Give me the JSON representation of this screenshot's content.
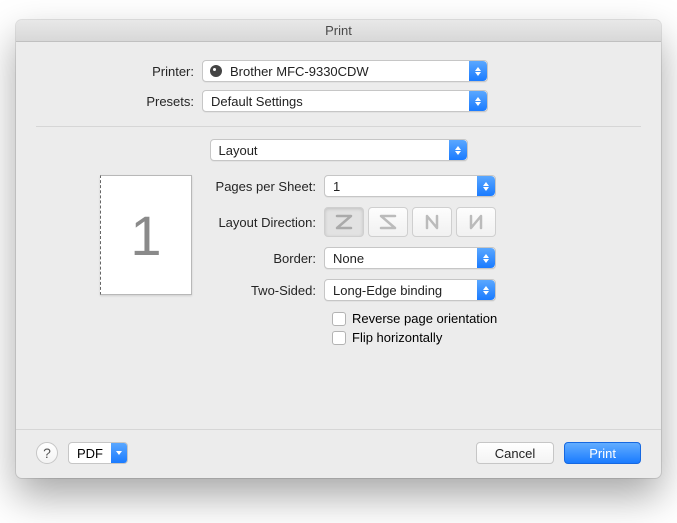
{
  "title": "Print",
  "labels": {
    "printer": "Printer:",
    "presets": "Presets:",
    "pagesPerSheet": "Pages per Sheet:",
    "layoutDirection": "Layout Direction:",
    "border": "Border:",
    "twoSided": "Two-Sided:"
  },
  "printer": {
    "selected": "Brother MFC-9330CDW"
  },
  "presets": {
    "selected": "Default Settings"
  },
  "panelSelect": {
    "selected": "Layout"
  },
  "preview": {
    "pageNumber": "1"
  },
  "pagesPerSheet": {
    "selected": "1"
  },
  "border": {
    "selected": "None"
  },
  "twoSided": {
    "selected": "Long-Edge binding"
  },
  "checkboxes": {
    "reverse": "Reverse page orientation",
    "flip": "Flip horizontally"
  },
  "footer": {
    "help": "?",
    "pdf": "PDF",
    "cancel": "Cancel",
    "print": "Print"
  }
}
